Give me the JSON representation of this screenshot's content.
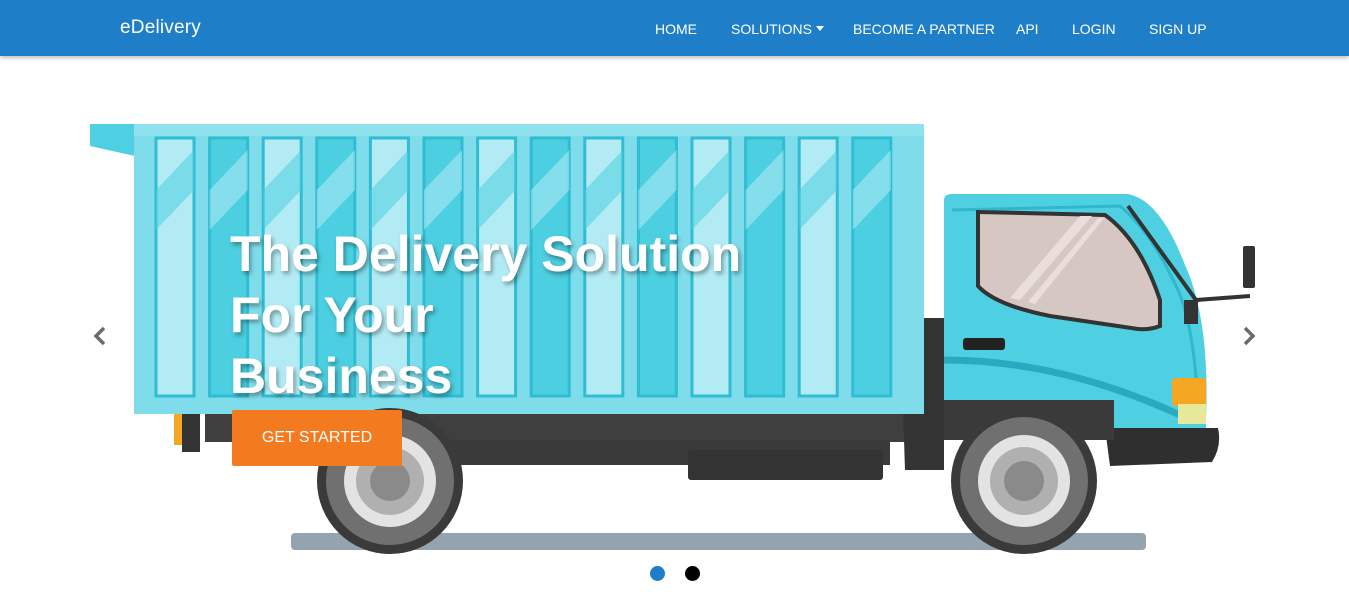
{
  "navbar": {
    "brand": "eDelivery",
    "links": [
      {
        "label": "HOME"
      },
      {
        "label": "SOLUTIONS",
        "dropdown": true
      },
      {
        "label": "BECOME A PARTNER"
      },
      {
        "label": "API"
      },
      {
        "label": "LOGIN"
      },
      {
        "label": "SIGN UP"
      }
    ],
    "color": "#1e7fc8"
  },
  "hero": {
    "headline": [
      "The Delivery Solution",
      "For Your",
      "Business"
    ],
    "cta_label": "GET STARTED",
    "cta_color": "#f47a20",
    "prev_icon": "chevron-left-icon",
    "next_icon": "chevron-right-icon",
    "slides_count": 2,
    "active_slide": 1
  },
  "colors": {
    "truck_body": "#4fd0e2",
    "truck_dark": "#3a3a3a",
    "dot_active": "#1e7fc8",
    "dot_inactive": "#000000"
  }
}
